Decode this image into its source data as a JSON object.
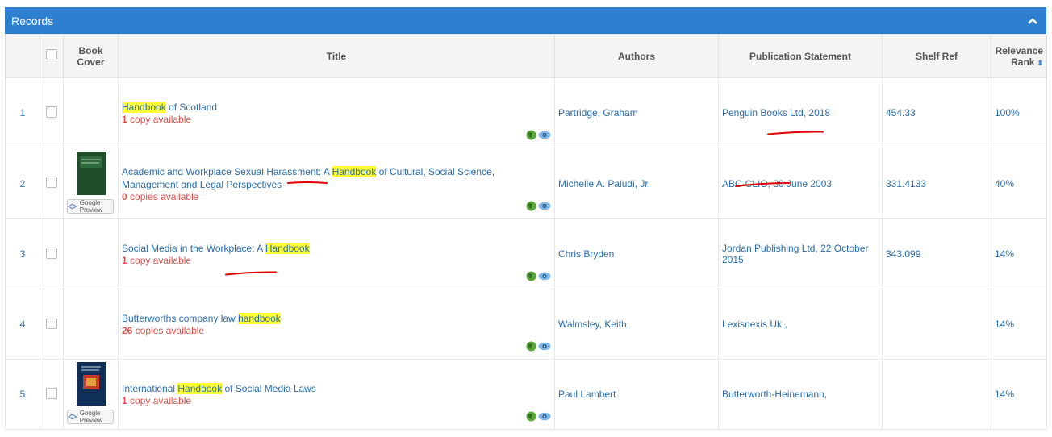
{
  "panel": {
    "title": "Records"
  },
  "columns": {
    "book_cover": "Book Cover",
    "title": "Title",
    "authors": "Authors",
    "publication": "Publication Statement",
    "shelf": "Shelf Ref",
    "relevance": "Relevance Rank"
  },
  "google_preview": "Google Preview",
  "rows": [
    {
      "n": "1",
      "t1": "",
      "hl": "Handbook",
      "t2": " of Scotland",
      "avail_num": "1",
      "avail_txt": " copy available",
      "author": "Partridge, Graham",
      "pub": "Penguin Books Ltd, 2018",
      "shelf": "454.33",
      "rank": "100%"
    },
    {
      "n": "2",
      "t1": "Academic and Workplace Sexual Harassment: A ",
      "hl": "Handbook",
      "t2": " of Cultural, Social Science, Management and Legal Perspectives",
      "avail_num": "0",
      "avail_txt": " copies available",
      "author": "Michelle A. Paludi, Jr.",
      "pub": "ABC-CLIO, 30 June 2003",
      "shelf": "331.4133",
      "rank": "40%"
    },
    {
      "n": "3",
      "t1": "Social Media in the Workplace: A ",
      "hl": "Handbook",
      "t2": "",
      "avail_num": "1",
      "avail_txt": " copy available",
      "author": "Chris Bryden",
      "pub": "Jordan Publishing Ltd, 22 October 2015",
      "shelf": "343.099",
      "rank": "14%"
    },
    {
      "n": "4",
      "t1": "Butterworths company law ",
      "hl": "handbook",
      "t2": "",
      "avail_num": "26",
      "avail_txt": " copies available",
      "author": "Walmsley, Keith,",
      "pub": "Lexisnexis Uk,,",
      "shelf": "",
      "rank": "14%"
    },
    {
      "n": "5",
      "t1": "International ",
      "hl": "Handbook",
      "t2": " of Social Media Laws",
      "avail_num": "1",
      "avail_txt": " copy available",
      "author": "Paul Lambert",
      "pub": "Butterworth-Heinemann,",
      "shelf": "",
      "rank": "14%"
    }
  ],
  "colors": {
    "header": "#2f7fd0",
    "highlight": "#ffff33",
    "availability": "#d9534f",
    "annotation": "#e00000"
  }
}
